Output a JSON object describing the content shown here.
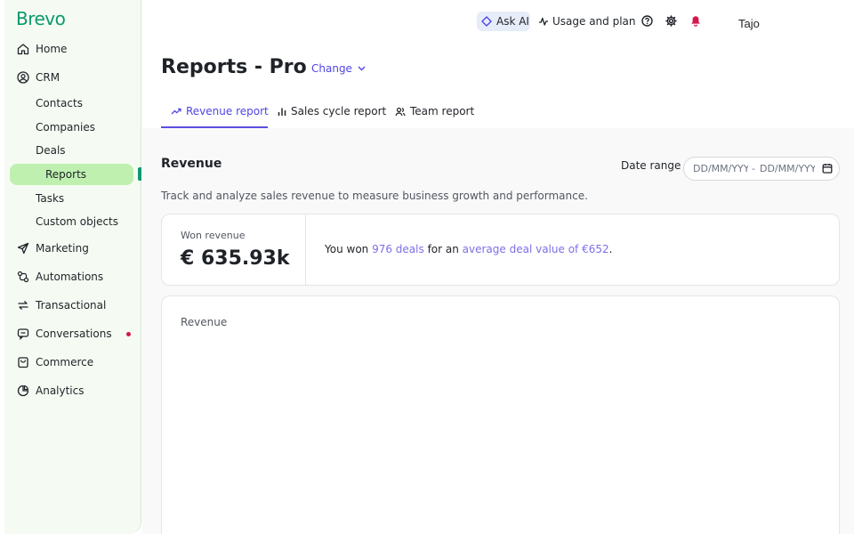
{
  "brand": {
    "logo_text": "Brevo",
    "color": "#0b996e"
  },
  "sidebar": {
    "items": [
      {
        "label": "Home",
        "icon": "home-icon"
      },
      {
        "label": "CRM",
        "icon": "user-circle-icon"
      },
      {
        "label": "Marketing",
        "icon": "send-icon"
      },
      {
        "label": "Automations",
        "icon": "automation-icon"
      },
      {
        "label": "Transactional",
        "icon": "arrows-icon"
      },
      {
        "label": "Conversations",
        "icon": "chat-icon"
      },
      {
        "label": "Commerce",
        "icon": "bag-icon"
      },
      {
        "label": "Analytics",
        "icon": "pie-chart-icon"
      }
    ],
    "crm_subitems": [
      {
        "label": "Contacts"
      },
      {
        "label": "Companies"
      },
      {
        "label": "Deals"
      },
      {
        "label": "Reports",
        "active": true
      },
      {
        "label": "Tasks"
      },
      {
        "label": "Custom objects"
      }
    ]
  },
  "topbar": {
    "ask_ai": "Ask AI",
    "usage": "Usage and plan",
    "icons": [
      "help-icon",
      "gear-icon",
      "bell-icon"
    ],
    "user": "Tajo"
  },
  "page": {
    "title": "Reports - Pro",
    "change_label": "Change"
  },
  "tabs": [
    {
      "label": "Revenue report",
      "icon": "trend-up-icon",
      "active": true
    },
    {
      "label": "Sales cycle report",
      "icon": "bar-chart-icon"
    },
    {
      "label": "Team report",
      "icon": "team-icon"
    }
  ],
  "revenue": {
    "title": "Revenue",
    "subtitle": "Track and analyze sales revenue to measure business growth and performance.",
    "date_range_label": "Date range",
    "date_start_placeholder": "DD/MM/YYYY",
    "date_separator": "-",
    "date_end_placeholder": "DD/MM/YYYY",
    "won_label": "Won revenue",
    "won_value": "€ 635.93k",
    "summary_prefix": "You won ",
    "deals_link": "976 deals",
    "summary_middle": " for an ",
    "avg_link": "average deal value of €652",
    "summary_suffix": ".",
    "chart_title": "Revenue"
  },
  "colors": {
    "accent": "#4f46e5",
    "link": "#7c6fe8",
    "active_nav_bg": "#bff0b0",
    "notification_dot": "#d3174d"
  }
}
